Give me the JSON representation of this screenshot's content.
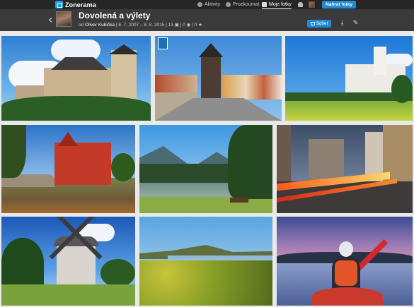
{
  "topnav": {
    "logo": "Zonerama",
    "items": [
      {
        "label": "Aktivity"
      },
      {
        "label": "Prozkoumat"
      },
      {
        "label": "Moje fotky"
      }
    ],
    "upload_label": "Nahrát fotky"
  },
  "album": {
    "title": "Dovolená a výlety",
    "by_prefix": "od",
    "owner": "Oliver Kubička",
    "date_range": "8. 7. 2007 – 8. 8. 2015",
    "photo_count": "13",
    "views": "0",
    "likes": "0",
    "share_label": "Sdílet"
  },
  "colors": {
    "accent": "#1f8ad3",
    "topbar": "#262626",
    "header": "#3a3a3a"
  },
  "icons": [
    "back-chevron-icon",
    "activity-icon",
    "explore-icon",
    "photos-icon",
    "bell-icon",
    "share-icon",
    "download-icon",
    "edit-icon",
    "bookmark-icon"
  ]
}
